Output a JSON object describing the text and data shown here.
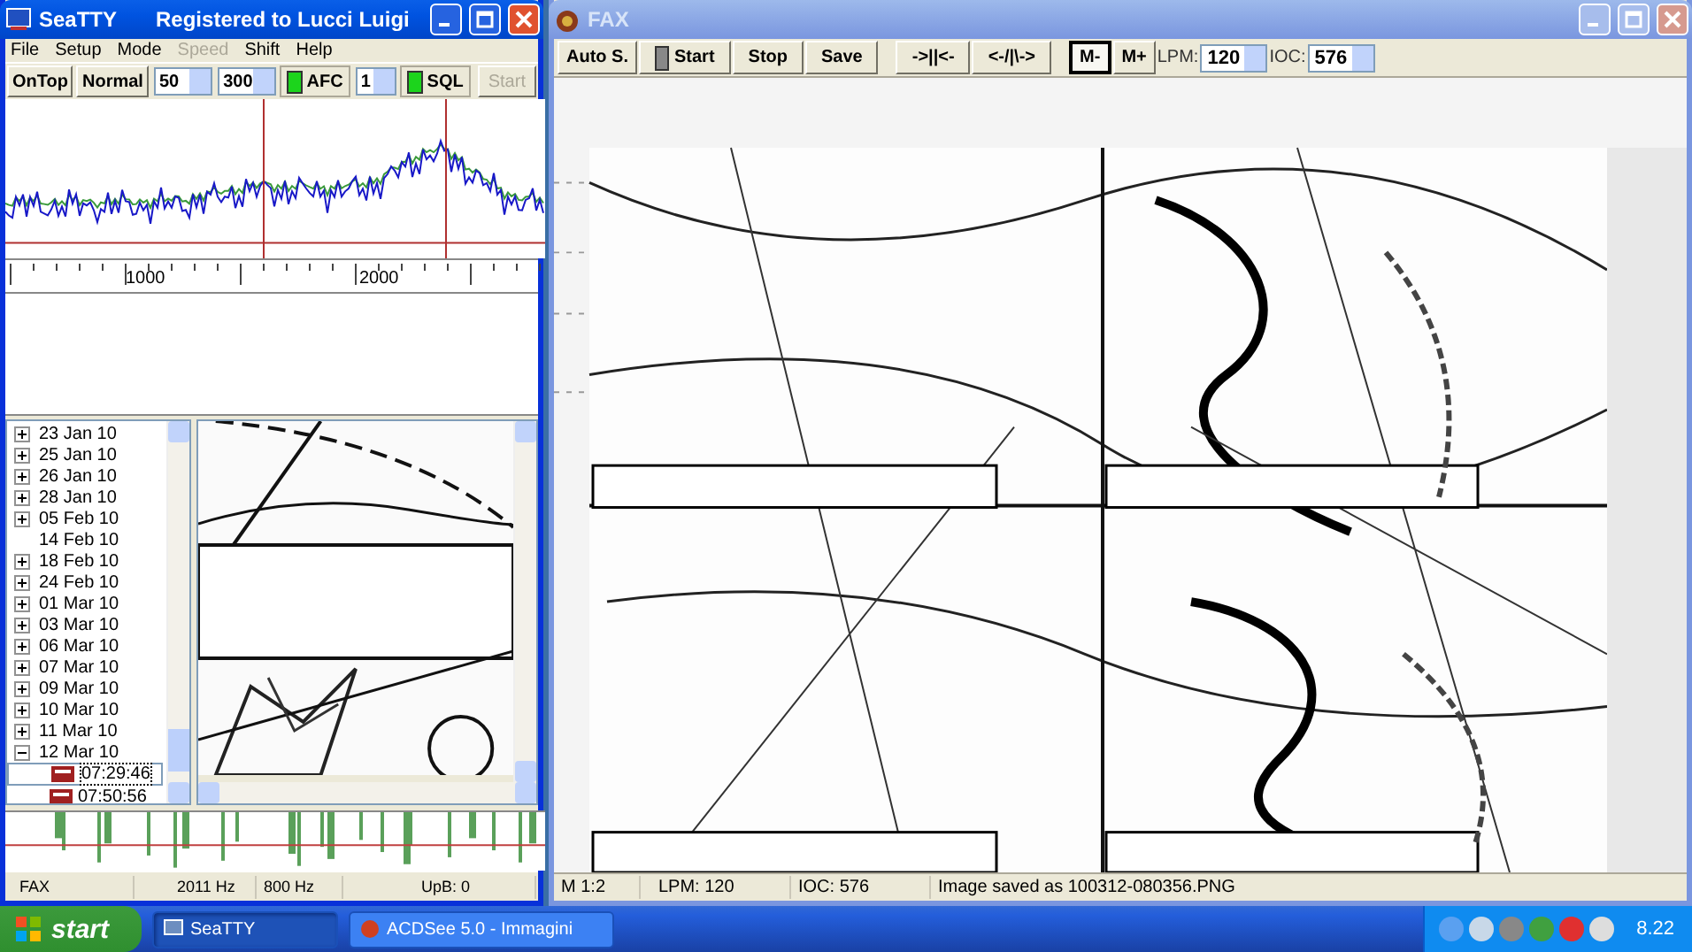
{
  "seatty": {
    "title": "SeaTTY",
    "subtitle": "Registered to Lucci Luigi",
    "active": true,
    "menu": [
      {
        "label": "File",
        "disabled": false
      },
      {
        "label": "Setup",
        "disabled": false
      },
      {
        "label": "Mode",
        "disabled": false
      },
      {
        "label": "Speed",
        "disabled": true
      },
      {
        "label": "Shift",
        "disabled": false
      },
      {
        "label": "Help",
        "disabled": false
      }
    ],
    "toolbar": [
      {
        "kind": "button",
        "label": "OnTop",
        "disabled": false
      },
      {
        "kind": "button",
        "label": "Normal",
        "disabled": false
      },
      {
        "kind": "spin",
        "value": "50",
        "disabled": false
      },
      {
        "kind": "spin",
        "value": "300",
        "disabled": false
      },
      {
        "kind": "check",
        "label": "AFC",
        "checked": true,
        "disabled": false
      },
      {
        "kind": "spin",
        "value": "1",
        "disabled": false
      },
      {
        "kind": "check",
        "label": "SQL",
        "checked": true,
        "disabled": false
      },
      {
        "kind": "button",
        "label": "Start",
        "disabled": true
      }
    ],
    "scale_labels": [
      "1000",
      "2000"
    ],
    "tree": [
      {
        "label": "23 Jan 10",
        "expandable": true,
        "expanded": false,
        "selected": false
      },
      {
        "label": "25 Jan 10",
        "expandable": true,
        "expanded": false,
        "selected": false
      },
      {
        "label": "26 Jan 10",
        "expandable": true,
        "expanded": false,
        "selected": false
      },
      {
        "label": "28 Jan 10",
        "expandable": true,
        "expanded": false,
        "selected": false
      },
      {
        "label": "05 Feb 10",
        "expandable": true,
        "expanded": false,
        "selected": false
      },
      {
        "label": "14 Feb 10",
        "expandable": false,
        "selected": false
      },
      {
        "label": "18 Feb 10",
        "expandable": true,
        "expanded": false,
        "selected": false
      },
      {
        "label": "24 Feb 10",
        "expandable": true,
        "expanded": false,
        "selected": false
      },
      {
        "label": "01 Mar 10",
        "expandable": true,
        "expanded": false,
        "selected": false
      },
      {
        "label": "03 Mar 10",
        "expandable": true,
        "expanded": false,
        "selected": false
      },
      {
        "label": "06 Mar 10",
        "expandable": true,
        "expanded": false,
        "selected": false
      },
      {
        "label": "07 Mar 10",
        "expandable": true,
        "expanded": false,
        "selected": false
      },
      {
        "label": "09 Mar 10",
        "expandable": true,
        "expanded": false,
        "selected": false
      },
      {
        "label": "10 Mar 10",
        "expandable": true,
        "expanded": false,
        "selected": false
      },
      {
        "label": "11 Mar 10",
        "expandable": true,
        "expanded": false,
        "selected": false
      },
      {
        "label": "12 Mar 10",
        "expandable": true,
        "expanded": true,
        "selected": false,
        "children": [
          {
            "label": "07:29:46",
            "selected": true
          },
          {
            "label": "07:50:56",
            "selected": false
          }
        ]
      }
    ],
    "status": [
      "FAX",
      "2011 Hz",
      "800 Hz",
      "UpB: 0"
    ]
  },
  "fax": {
    "title": "FAX",
    "active": false,
    "toolbar": [
      [
        {
          "kind": "button",
          "label": "Auto S."
        },
        {
          "kind": "led",
          "label": "Start"
        },
        {
          "kind": "button",
          "label": "Stop"
        },
        {
          "kind": "button",
          "label": "Save"
        }
      ],
      [
        {
          "kind": "button",
          "label": "->||<-"
        },
        {
          "kind": "button",
          "label": "<-/|\\->"
        }
      ],
      [
        {
          "kind": "toggle",
          "label": "M-",
          "selected": true
        },
        {
          "kind": "toggle",
          "label": "M+",
          "selected": false
        },
        {
          "kind": "combo",
          "label": "LPM:",
          "value": "120"
        },
        {
          "kind": "combo",
          "label": "IOC:",
          "value": "576"
        }
      ]
    ],
    "status": [
      "M 1:2",
      "LPM: 120",
      "IOC: 576",
      "Image saved as 100312-080356.PNG"
    ]
  },
  "taskbar": {
    "start": "start",
    "tasks": [
      {
        "label": "SeaTTY",
        "selected": true
      },
      {
        "label": "ACDSee 5.0 - Immagini",
        "selected": false
      }
    ],
    "clock": "8.22"
  }
}
